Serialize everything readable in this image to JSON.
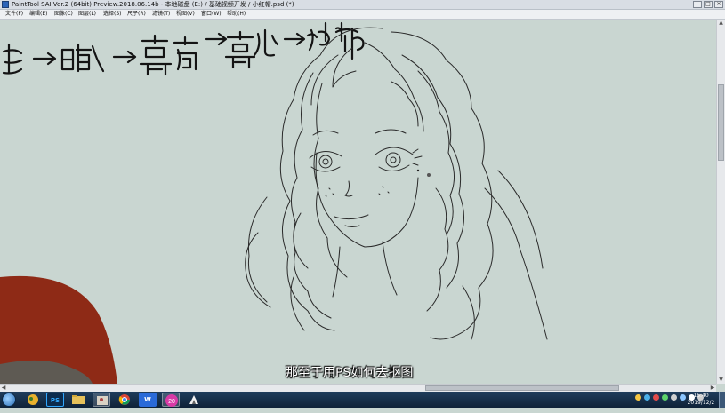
{
  "window": {
    "title": "PaintTool SAI Ver.2 (64bit) Preview.2018.06.14b - 本地磁盘 (E:) / 基础视频开发 / 小红帽.psd (*)",
    "btn_min": "–",
    "btn_max": "□",
    "btn_close": "×"
  },
  "menu": {
    "items": [
      "文件(F)",
      "编辑(E)",
      "图像(C)",
      "图层(L)",
      "选择(S)",
      "尺子(R)",
      "滤镜(T)",
      "视图(V)",
      "窗口(W)",
      "帮助(H)"
    ]
  },
  "scroll": {
    "up": "▲",
    "down": "▼",
    "left": "◀",
    "right": "▶"
  },
  "video": {
    "subtitle": "那至于用PS如何去抠图"
  },
  "taskbar": {
    "apps": [
      "PS",
      "W"
    ],
    "badge": "20",
    "clock_time": "16:40",
    "clock_date": "2019/12/2"
  },
  "colors": {
    "canvas": "#c9d6d1",
    "line_art": "#2a2a2a",
    "red_shape": "#8e2a16",
    "taskbar": "#1a3350"
  }
}
